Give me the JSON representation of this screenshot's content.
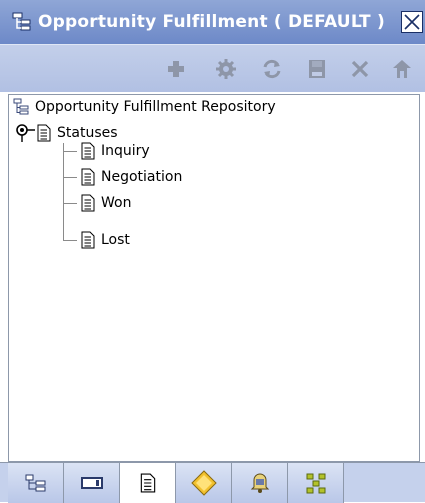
{
  "window": {
    "title": "Opportunity Fulfillment ( DEFAULT )"
  },
  "toolbar": {
    "buttons": [
      {
        "name": "add-icon",
        "enabled": false
      },
      {
        "name": "gear-icon",
        "enabled": false
      },
      {
        "name": "refresh-icon",
        "enabled": false
      },
      {
        "name": "save-icon",
        "enabled": false
      },
      {
        "name": "delete-icon",
        "enabled": false
      },
      {
        "name": "export-icon",
        "enabled": false
      }
    ]
  },
  "tree": {
    "root": {
      "label": "Opportunity Fulfillment Repository",
      "icon": "tree-structure-icon"
    },
    "statuses": {
      "label": "Statuses",
      "expanded": true,
      "children": [
        {
          "label": "Inquiry"
        },
        {
          "label": "Negotiation"
        },
        {
          "label": "Won"
        },
        {
          "label": "Lost"
        }
      ]
    }
  },
  "tabs": [
    {
      "name": "tab-hierarchy",
      "icon": "hierarchy-icon",
      "active": false
    },
    {
      "name": "tab-forms",
      "icon": "window-icon",
      "active": false
    },
    {
      "name": "tab-documents",
      "icon": "document-icon",
      "active": true
    },
    {
      "name": "tab-rules",
      "icon": "diamond-icon",
      "active": false
    },
    {
      "name": "tab-alerts",
      "icon": "bell-icon",
      "active": false
    },
    {
      "name": "tab-network",
      "icon": "network-icon",
      "active": false
    }
  ],
  "colors": {
    "titlebar": "#7a93cc",
    "toolbar": "#bac8e6",
    "disabled_icon": "#8e96a8"
  }
}
